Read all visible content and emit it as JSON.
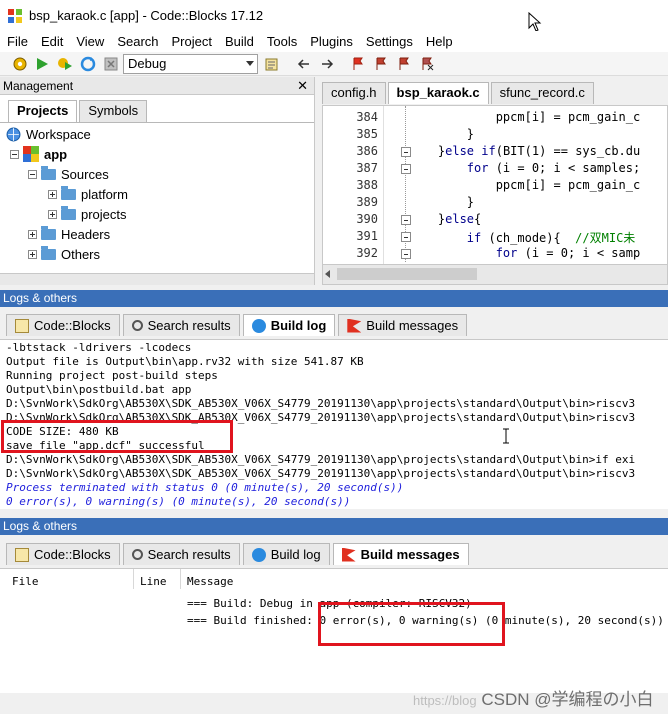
{
  "window": {
    "title": "bsp_karaok.c [app] - Code::Blocks 17.12"
  },
  "menu": [
    "File",
    "Edit",
    "View",
    "Search",
    "Project",
    "Build",
    "Tools",
    "Plugins",
    "Settings",
    "Help"
  ],
  "toolbar": {
    "build_target": "Debug"
  },
  "management": {
    "title": "Management",
    "close": "✕",
    "tabs": [
      "Projects",
      "Symbols"
    ],
    "tree": {
      "workspace": "Workspace",
      "project": "app",
      "sources": "Sources",
      "platform": "platform",
      "projects": "projects",
      "headers": "Headers",
      "others": "Others"
    }
  },
  "editor": {
    "tabs": [
      "config.h",
      "bsp_karaok.c",
      "sfunc_record.c"
    ],
    "active_tab": "bsp_karaok.c",
    "lines": [
      {
        "n": "384",
        "code": "            ppcm[i] = pcm_gain_c"
      },
      {
        "n": "385",
        "code": "        }"
      },
      {
        "n": "386",
        "code": "    }else if(BIT(1) == sys_cb.du"
      },
      {
        "n": "387",
        "code": "        for (i = 0; i < samples;"
      },
      {
        "n": "388",
        "code": "            ppcm[i] = pcm_gain_c"
      },
      {
        "n": "389",
        "code": "        }"
      },
      {
        "n": "390",
        "code": "    }else{"
      },
      {
        "n": "391",
        "code": "        if (ch_mode){  //双MIC未"
      },
      {
        "n": "392",
        "code": "            for (i = 0; i < samp"
      }
    ]
  },
  "logs_top": {
    "title": "Logs & others",
    "tabs": [
      "Code::Blocks",
      "Search results",
      "Build log",
      "Build messages"
    ],
    "active_tab": "Build log",
    "lines": [
      "-lbtstack -ldrivers -lcodecs",
      "Output file is Output\\bin\\app.rv32 with size 541.87 KB",
      "Running project post-build steps",
      "Output\\bin\\postbuild.bat app",
      "D:\\SvnWork\\SdkOrg\\AB530X\\SDK_AB530X_V06X_S4779_20191130\\app\\projects\\standard\\Output\\bin>riscv3",
      "D:\\SvnWork\\SdkOrg\\AB530X\\SDK_AB530X_V06X_S4779_20191130\\app\\projects\\standard\\Output\\bin>riscv3",
      "CODE SIZE: 480 KB",
      "save file \"app.dcf\" successful",
      "D:\\SvnWork\\SdkOrg\\AB530X\\SDK_AB530X_V06X_S4779_20191130\\app\\projects\\standard\\Output\\bin>if exi",
      "D:\\SvnWork\\SdkOrg\\AB530X\\SDK_AB530X_V06X_S4779_20191130\\app\\projects\\standard\\Output\\bin>riscv3",
      "Process terminated with status 0 (0 minute(s), 20 second(s))",
      "0 error(s), 0 warning(s) (0 minute(s), 20 second(s))"
    ]
  },
  "logs_bottom": {
    "title": "Logs & others",
    "tabs": [
      "Code::Blocks",
      "Search results",
      "Build log",
      "Build messages"
    ],
    "active_tab": "Build messages",
    "columns": [
      "File",
      "Line",
      "Message"
    ],
    "messages": [
      "=== Build: Debug in app (compiler: RISCV32) ===",
      "=== Build finished: 0 error(s), 0 warning(s) (0 minute(s), 20 second(s)) ==="
    ]
  },
  "watermark": {
    "url": "https://blog",
    "text": "CSDN @学编程の小白"
  },
  "colors": {
    "logs_bar": "#3a6fb8",
    "highlight_box": "#e0141e",
    "blue_log": "#1e1edc"
  }
}
